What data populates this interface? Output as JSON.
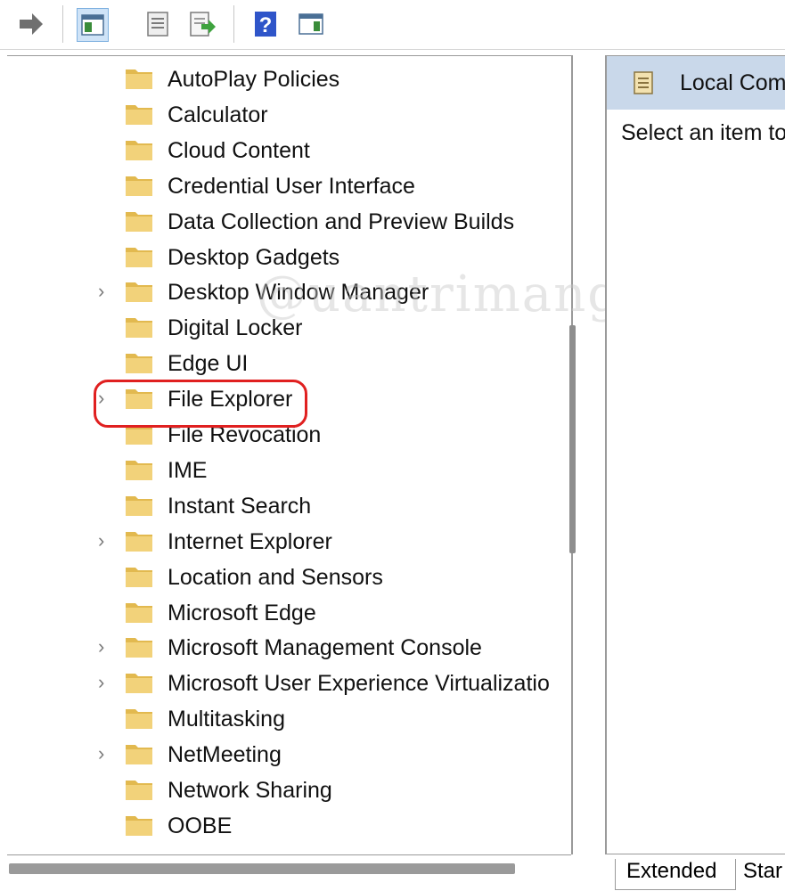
{
  "toolbar": {
    "buttons": [
      "forward-icon",
      "show-hide-console-tree-icon",
      "properties-icon",
      "export-list-icon",
      "help-icon",
      "show-action-pane-icon"
    ]
  },
  "tree": {
    "items": [
      {
        "label": "AutoPlay Policies",
        "expandable": false
      },
      {
        "label": "Calculator",
        "expandable": false
      },
      {
        "label": "Cloud Content",
        "expandable": false
      },
      {
        "label": "Credential User Interface",
        "expandable": false
      },
      {
        "label": "Data Collection and Preview Builds",
        "expandable": false
      },
      {
        "label": "Desktop Gadgets",
        "expandable": false
      },
      {
        "label": "Desktop Window Manager",
        "expandable": true
      },
      {
        "label": "Digital Locker",
        "expandable": false
      },
      {
        "label": "Edge UI",
        "expandable": false
      },
      {
        "label": "File Explorer",
        "expandable": true,
        "highlighted": true
      },
      {
        "label": "File Revocation",
        "expandable": false
      },
      {
        "label": "IME",
        "expandable": false
      },
      {
        "label": "Instant Search",
        "expandable": false
      },
      {
        "label": "Internet Explorer",
        "expandable": true
      },
      {
        "label": "Location and Sensors",
        "expandable": false
      },
      {
        "label": "Microsoft Edge",
        "expandable": false
      },
      {
        "label": "Microsoft Management Console",
        "expandable": true
      },
      {
        "label": "Microsoft User Experience Virtualizatio",
        "expandable": true
      },
      {
        "label": "Multitasking",
        "expandable": false
      },
      {
        "label": "NetMeeting",
        "expandable": true
      },
      {
        "label": "Network Sharing",
        "expandable": false
      },
      {
        "label": "OOBE",
        "expandable": false
      }
    ]
  },
  "right_pane": {
    "title": "Local Com",
    "text": "Select an item to"
  },
  "tabs": {
    "extended": "Extended",
    "standard": "Star"
  },
  "watermark": "@uantrimang",
  "colors": {
    "header_bg": "#c9d8ea",
    "highlight": "#e02020",
    "folder": "#f2d27a"
  }
}
